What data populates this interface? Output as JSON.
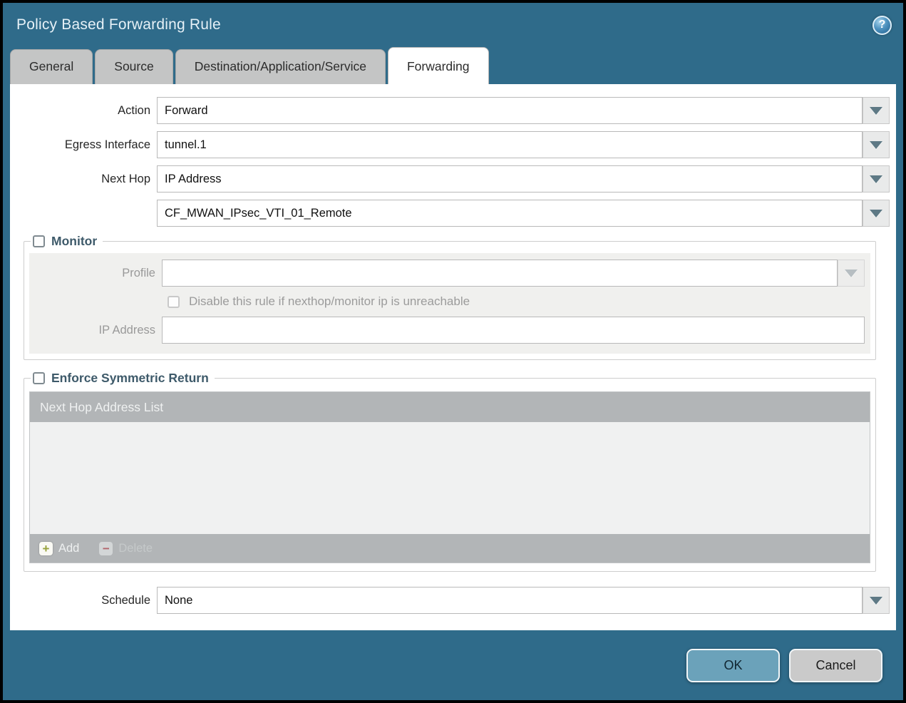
{
  "window": {
    "title": "Policy Based Forwarding Rule"
  },
  "tabs": [
    {
      "label": "General",
      "active": false
    },
    {
      "label": "Source",
      "active": false
    },
    {
      "label": "Destination/Application/Service",
      "active": false
    },
    {
      "label": "Forwarding",
      "active": true
    }
  ],
  "form": {
    "action": {
      "label": "Action",
      "value": "Forward"
    },
    "egress_interface": {
      "label": "Egress Interface",
      "value": "tunnel.1"
    },
    "next_hop": {
      "label": "Next Hop",
      "value": "IP Address"
    },
    "next_hop_address": {
      "value": "CF_MWAN_IPsec_VTI_01_Remote"
    },
    "schedule": {
      "label": "Schedule",
      "value": "None"
    }
  },
  "monitor": {
    "title": "Monitor",
    "checked": false,
    "profile_label": "Profile",
    "profile_value": "",
    "disable_label": "Disable this rule if nexthop/monitor ip is unreachable",
    "disable_checked": false,
    "ip_label": "IP Address",
    "ip_value": ""
  },
  "symmetric": {
    "title": "Enforce Symmetric Return",
    "checked": false,
    "table_header": "Next Hop Address List",
    "rows": [],
    "add_label": "Add",
    "delete_label": "Delete"
  },
  "footer": {
    "ok": "OK",
    "cancel": "Cancel"
  },
  "icons": {
    "help": "?",
    "add": "+",
    "delete": "−"
  },
  "colors": {
    "titlebar": "#2f6b8a",
    "tab_inactive": "#c4c5c5",
    "profile_disabled_bg": "#f4eeda",
    "table_header_bg": "#b2b5b7",
    "ok_button_bg": "#6ba2ba",
    "cancel_button_bg": "#cacaca"
  }
}
